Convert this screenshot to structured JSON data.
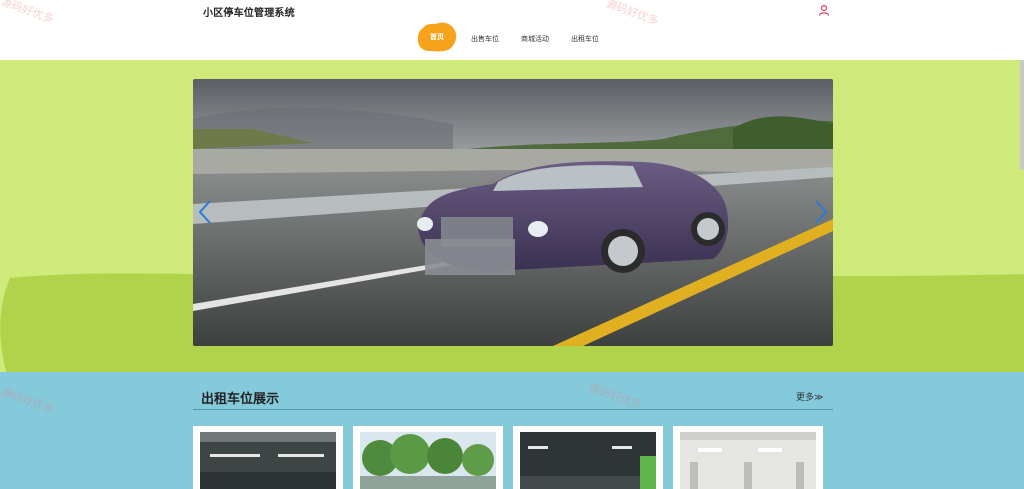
{
  "header": {
    "site_title": "小区停车位管理系统",
    "user_icon": "user-icon"
  },
  "nav": {
    "items": [
      {
        "label": "首页",
        "active": true
      },
      {
        "label": "出售车位",
        "active": false
      },
      {
        "label": "商城活动",
        "active": false
      },
      {
        "label": "出租车位",
        "active": false
      }
    ]
  },
  "banner": {
    "prev_icon": "chevron-left-icon",
    "next_icon": "chevron-right-icon"
  },
  "rent_section": {
    "title": "出租车位展示",
    "more_label": "更多≫"
  },
  "watermarks": [
    "源码好优多",
    "源码好优多",
    "源码好优多",
    "源码好优多"
  ],
  "colors": {
    "accent": "#f7a21b",
    "banner_bg": "#cfe97a",
    "blob": "#b1d34b",
    "section_bg": "#85cadb",
    "arrow": "#2a7bd6"
  }
}
